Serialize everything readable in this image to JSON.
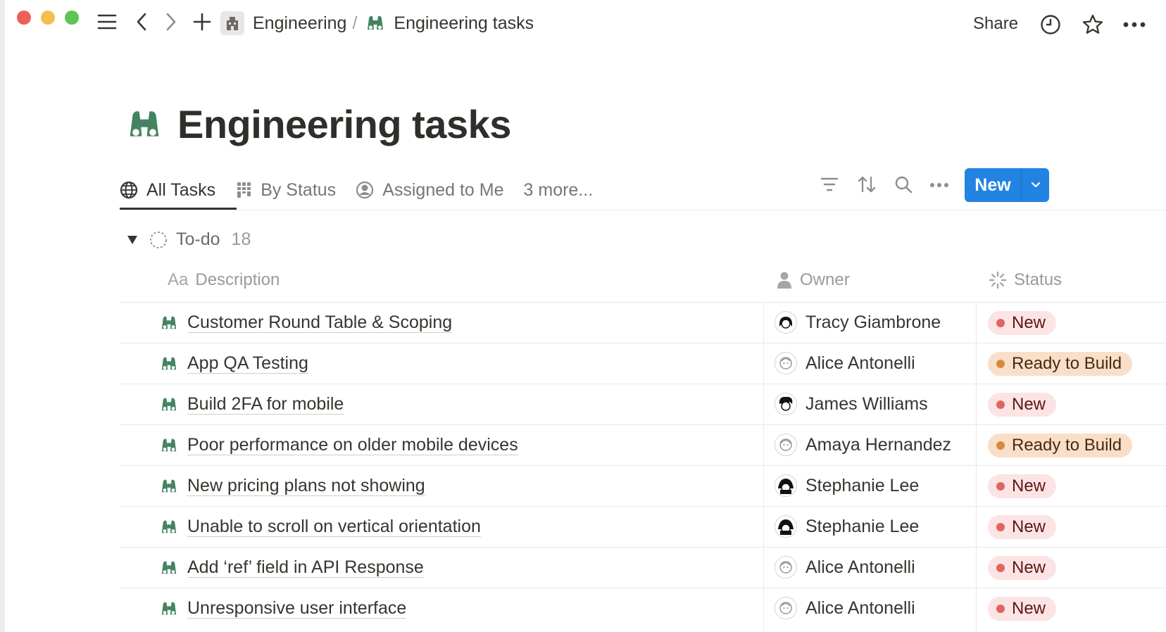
{
  "topbar": {
    "breadcrumb_parent": "Engineering",
    "breadcrumb_separator": "/",
    "breadcrumb_current": "Engineering tasks",
    "share_label": "Share"
  },
  "page": {
    "title": "Engineering tasks"
  },
  "views": {
    "tabs": [
      {
        "label": "All Tasks",
        "icon": "globe-icon",
        "active": true
      },
      {
        "label": "By Status",
        "icon": "board-icon",
        "active": false
      },
      {
        "label": "Assigned to Me",
        "icon": "user-circle-icon",
        "active": false
      }
    ],
    "more_label": "3 more...",
    "new_label": "New"
  },
  "group": {
    "name": "To-do",
    "count": "18"
  },
  "columns": {
    "description_prefix": "Aa",
    "description": "Description",
    "owner": "Owner",
    "status": "Status"
  },
  "rows": [
    {
      "description": "Customer Round Table & Scoping",
      "owner": "Tracy Giambrone",
      "status": "New",
      "avatar": "tracy"
    },
    {
      "description": "App QA Testing",
      "owner": "Alice Antonelli",
      "status": "Ready to Build",
      "avatar": "alice"
    },
    {
      "description": "Build 2FA for mobile",
      "owner": "James Williams",
      "status": "New",
      "avatar": "james"
    },
    {
      "description": "Poor performance on older mobile devices",
      "owner": "Amaya Hernandez",
      "status": "Ready to Build",
      "avatar": "amaya"
    },
    {
      "description": "New pricing plans not showing",
      "owner": "Stephanie Lee",
      "status": "New",
      "avatar": "stephanie"
    },
    {
      "description": "Unable to scroll on vertical orientation",
      "owner": "Stephanie Lee",
      "status": "New",
      "avatar": "stephanie"
    },
    {
      "description": "Add ‘ref’ field in API Response",
      "owner": "Alice Antonelli",
      "status": "New",
      "avatar": "alice"
    },
    {
      "description": "Unresponsive user interface",
      "owner": "Alice Antonelli",
      "status": "New",
      "avatar": "alice"
    }
  ],
  "colors": {
    "accent": "#2383e2",
    "binoculars": "#448361",
    "status_new_bg": "#fbe4e3",
    "status_ready_bg": "#f9dfc9"
  }
}
